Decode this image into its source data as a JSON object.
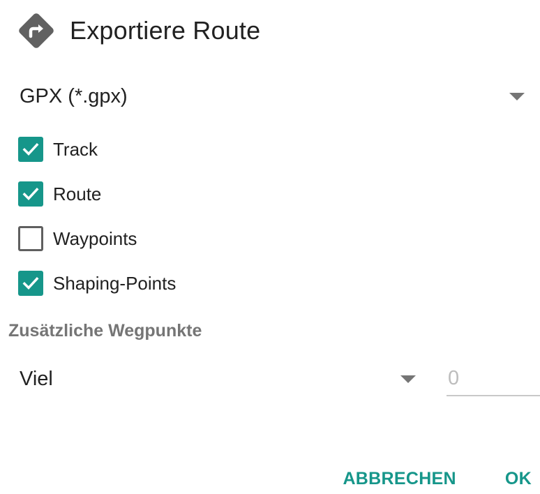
{
  "dialog": {
    "title": "Exportiere Route",
    "icon": "route-turn-icon"
  },
  "format": {
    "selected": "GPX (*.gpx)"
  },
  "options": [
    {
      "label": "Track",
      "checked": true
    },
    {
      "label": "Route",
      "checked": true
    },
    {
      "label": "Waypoints",
      "checked": false
    },
    {
      "label": "Shaping-Points",
      "checked": true
    }
  ],
  "extra_waypoints": {
    "header": "Zusätzliche Wegpunkte",
    "selected": "Viel",
    "number_placeholder": "0"
  },
  "actions": {
    "cancel_label": "ABBRECHEN",
    "ok_label": "OK"
  },
  "colors": {
    "accent": "#16968a",
    "icon": "#616161"
  }
}
